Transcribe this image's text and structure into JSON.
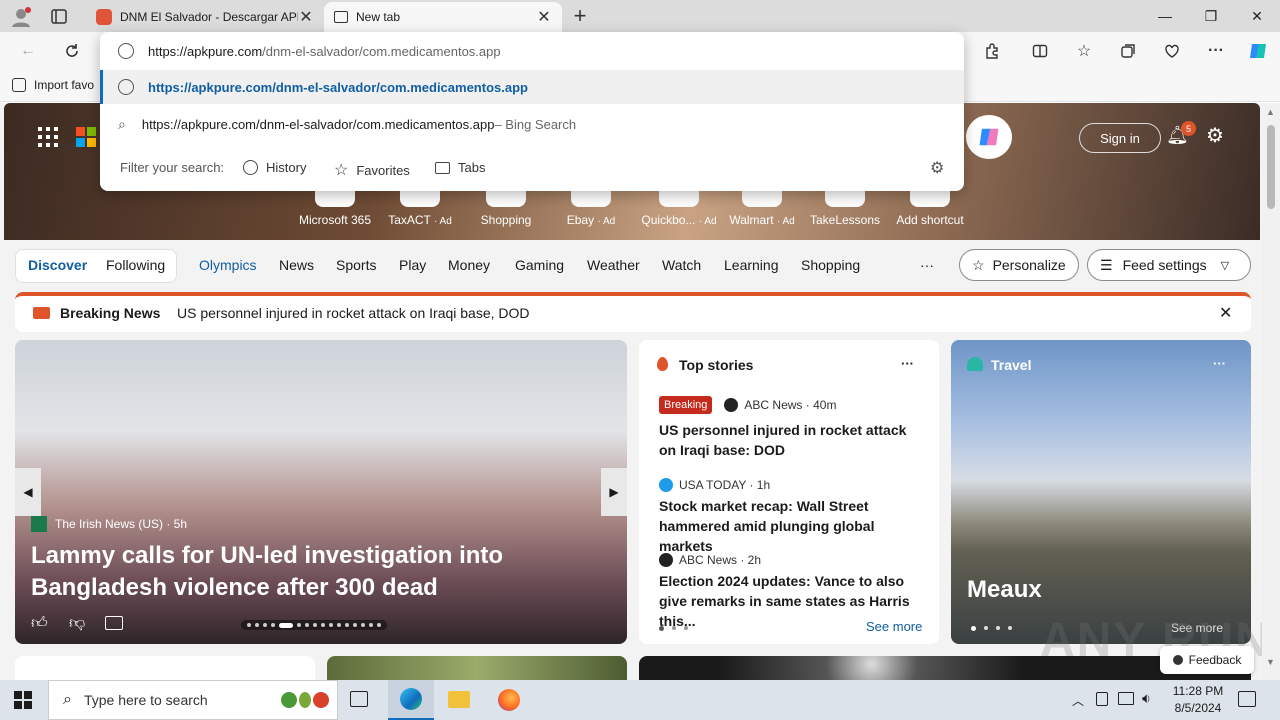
{
  "browser": {
    "tabs": [
      {
        "title": "DNM El Salvador - Descargar APK",
        "close": "✕"
      },
      {
        "title": "New tab",
        "close": "✕"
      }
    ],
    "new_tab": "+",
    "window": {
      "minimize": "—",
      "maximize": "❐",
      "close": "✕"
    },
    "favorites_bar": {
      "import": "Import favo"
    }
  },
  "omnibox": {
    "value_prefix": "https://apkpure.com",
    "value_suffix": "/dnm-el-salvador/com.medicamentos.app",
    "suggestions": [
      {
        "text": "https://apkpure.com/dnm-el-salvador/com.medicamentos.app",
        "suffix": ""
      },
      {
        "text": "https://apkpure.com/dnm-el-salvador/com.medicamentos.app",
        "suffix": " – Bing Search"
      }
    ],
    "filter_label": "Filter your search:",
    "filters": [
      "History",
      "Favorites",
      "Tabs"
    ]
  },
  "hero": {
    "sign_in": "Sign in",
    "notif_count": "5",
    "shortcuts": [
      {
        "label": "Microsoft 365",
        "ad": ""
      },
      {
        "label": "TaxACT",
        "ad": "· Ad"
      },
      {
        "label": "Shopping",
        "ad": ""
      },
      {
        "label": "Ebay",
        "ad": "· Ad"
      },
      {
        "label": "Quickbo...",
        "ad": "· Ad"
      },
      {
        "label": "Walmart",
        "ad": "· Ad"
      },
      {
        "label": "TakeLessons",
        "ad": ""
      },
      {
        "label": "Add shortcut",
        "ad": ""
      }
    ]
  },
  "nav": {
    "discover": "Discover",
    "following": "Following",
    "items": [
      "Olympics",
      "News",
      "Sports",
      "Play",
      "Money",
      "Gaming",
      "Weather",
      "Watch",
      "Learning",
      "Shopping"
    ],
    "more": "···",
    "personalize": "Personalize",
    "feed_settings": "Feed settings"
  },
  "breaking": {
    "label": "Breaking News",
    "text": "US personnel injured in rocket attack on Iraqi base, DOD"
  },
  "hero_card": {
    "source": "The Irish News (US) · 5h",
    "headline": "Lammy calls for UN-led investigation into Bangladesh violence after 300 dead"
  },
  "top_stories": {
    "title": "Top stories",
    "more": "···",
    "stories": [
      {
        "badge": "Breaking",
        "source": "ABC News · 40m",
        "headline": "US personnel injured in rocket attack on Iraqi base: DOD"
      },
      {
        "badge": "",
        "source": "USA TODAY · 1h",
        "headline": "Stock market recap: Wall Street hammered amid plunging global markets"
      },
      {
        "badge": "",
        "source": "ABC News · 2h",
        "headline": "Election 2024 updates: Vance to also give remarks in same states as Harris this..."
      }
    ],
    "see_more": "See more"
  },
  "travel": {
    "title": "Travel",
    "more": "···",
    "place": "Meaux",
    "see_more": "See more"
  },
  "feedback": "Feedback",
  "taskbar": {
    "search_placeholder": "Type here to search",
    "time": "11:28 PM",
    "date": "8/5/2024"
  },
  "watermark": "ANY RUN",
  "colors": {
    "accent": "#0f6cbd",
    "breaking_red": "#c42b1c",
    "link": "#115ea3"
  }
}
